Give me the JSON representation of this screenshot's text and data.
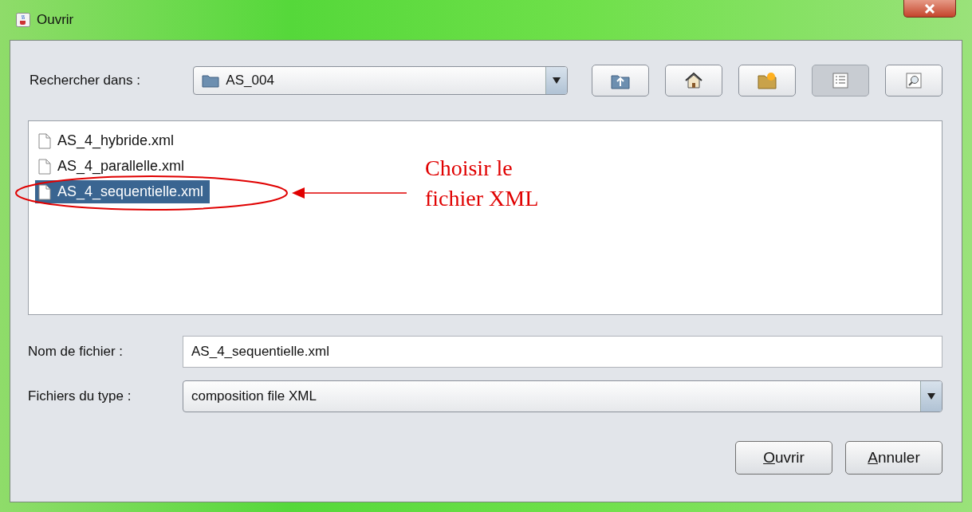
{
  "window": {
    "title": "Ouvrir"
  },
  "look_in": {
    "label": "Rechercher dans :",
    "value": "AS_004"
  },
  "toolbar": [
    {
      "kind": "up",
      "selected": false
    },
    {
      "kind": "home",
      "selected": false
    },
    {
      "kind": "new-folder",
      "selected": false
    },
    {
      "kind": "list",
      "selected": true
    },
    {
      "kind": "details",
      "selected": false
    }
  ],
  "files": [
    {
      "name": "AS_4_hybride.xml",
      "selected": false
    },
    {
      "name": "AS_4_parallelle.xml",
      "selected": false
    },
    {
      "name": "AS_4_sequentielle.xml",
      "selected": true
    }
  ],
  "annotation": {
    "text": "Choisir le fichier XML"
  },
  "file_name": {
    "label": "Nom de fichier :",
    "value": "AS_4_sequentielle.xml"
  },
  "file_type": {
    "label": "Fichiers du type :",
    "value": "composition file XML"
  },
  "buttons": [
    {
      "mnemonic": "O",
      "rest": "uvrir"
    },
    {
      "mnemonic": "A",
      "rest": "nnuler"
    }
  ]
}
